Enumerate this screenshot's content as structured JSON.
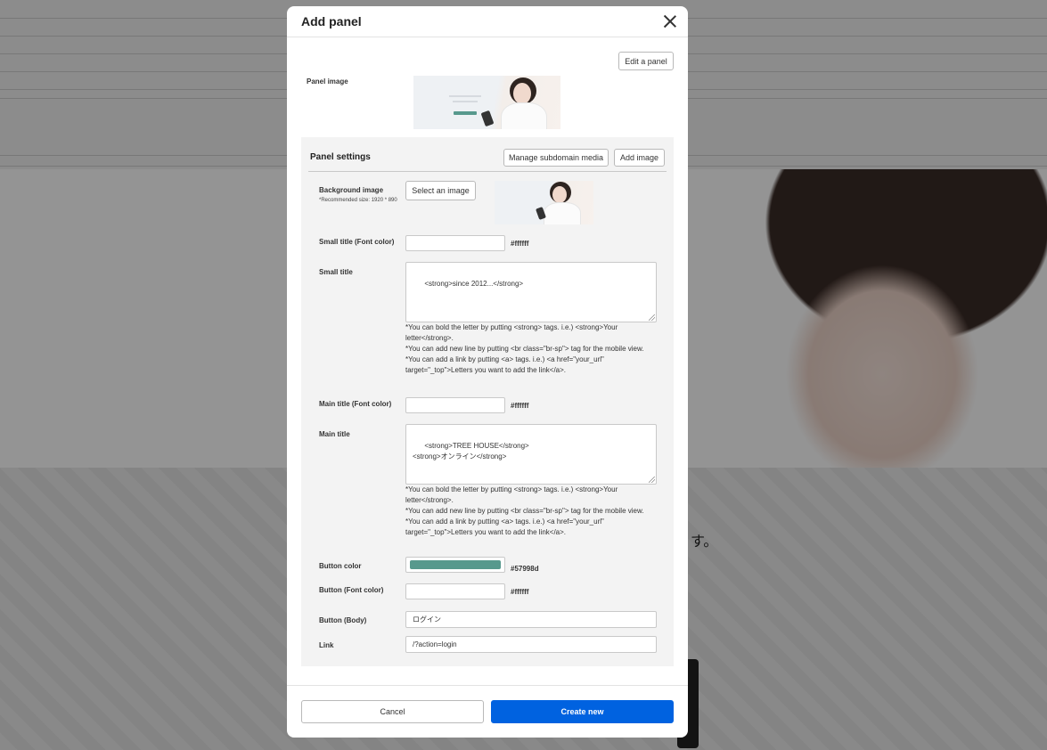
{
  "background_page": {
    "lower_text": "す。"
  },
  "modal": {
    "title": "Add panel",
    "edit_panel_label": "Edit a panel",
    "panel_image_label": "Panel image",
    "settings": {
      "title": "Panel settings",
      "manage_subdomain_label": "Manage subdomain media",
      "add_image_label": "Add image",
      "background_image": {
        "label": "Background image",
        "note": "*Recommended size: 1920 * 890",
        "button_label": "Select an image"
      },
      "small_title_font_color": {
        "label": "Small title (Font color)",
        "value": "",
        "hex": "#ffffff"
      },
      "small_title": {
        "label": "Small title",
        "value": "<strong>since 2012...</strong>",
        "help": [
          "*You can bold the letter by putting <strong> tags. i.e.) <strong>Your letter</strong>.",
          "*You can add new line by putting <br class=\"br-sp\"> tag for the mobile view.",
          "*You can add a link by putting <a> tags. i.e.) <a href=\"your_url\" target=\"_top\">Letters you want to add the link</a>."
        ]
      },
      "main_title_font_color": {
        "label": "Main title (Font color)",
        "value": "",
        "hex": "#ffffff"
      },
      "main_title": {
        "label": "Main title",
        "value": "<strong>TREE HOUSE</strong>\n<strong>オンライン</strong>",
        "help": [
          "*You can bold the letter by putting <strong> tags. i.e.) <strong>Your letter</strong>.",
          "*You can add new line by putting <br class=\"br-sp\"> tag for the mobile view.",
          "*You can add a link by putting <a> tags. i.e.) <a href=\"your_url\" target=\"_top\">Letters you want to add the link</a>."
        ]
      },
      "button_color": {
        "label": "Button color",
        "swatch": "#57998d",
        "hex": "#57998d"
      },
      "button_font_color": {
        "label": "Button (Font color)",
        "value": "",
        "hex": "#ffffff"
      },
      "button_body": {
        "label": "Button (Body)",
        "value": "ログイン"
      },
      "link": {
        "label": "Link",
        "value": "/?action=login"
      }
    },
    "footer": {
      "cancel_label": "Cancel",
      "create_label": "Create new"
    }
  },
  "colors": {
    "primary_button": "#0062e0",
    "settings_background": "#f3f3f3",
    "accent_green": "#57998d"
  }
}
